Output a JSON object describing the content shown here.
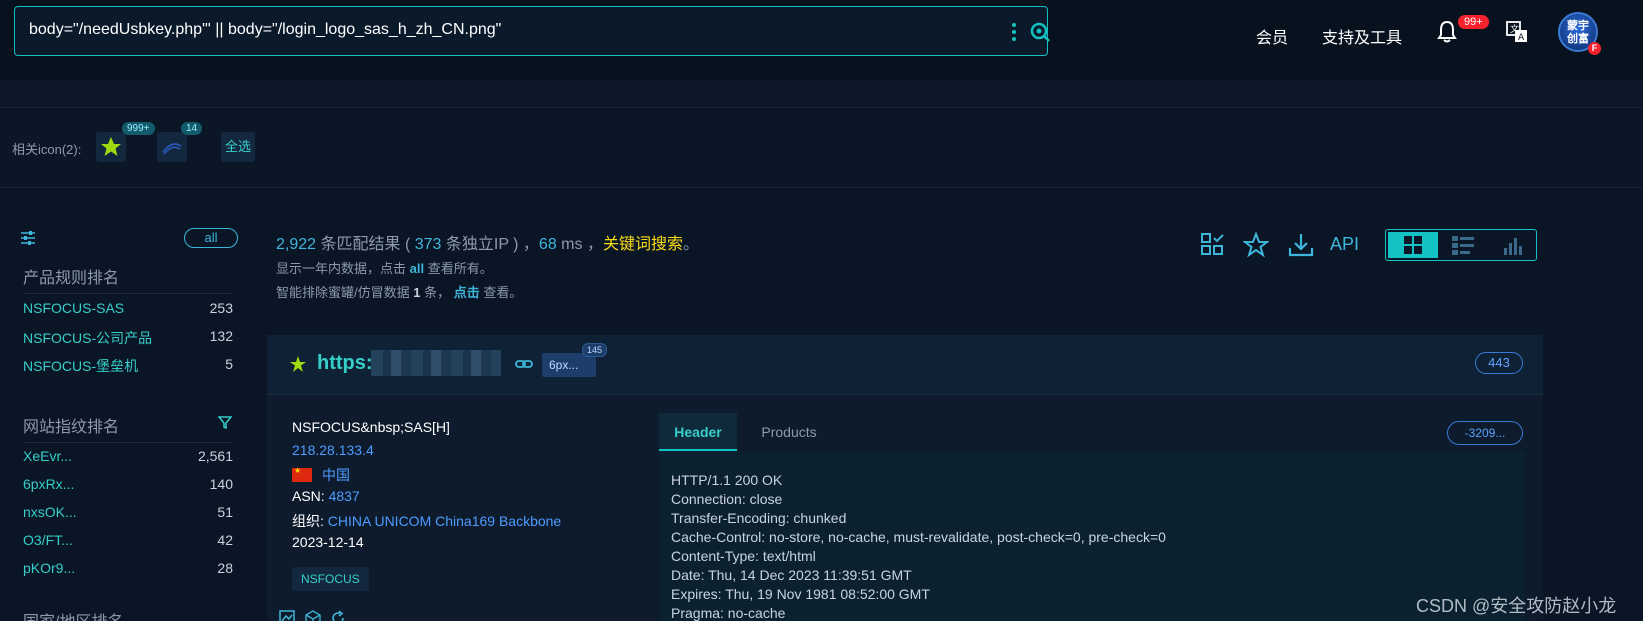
{
  "search": {
    "query": "body=\"/needUsbkey.php\"' || body=\"/login_logo_sas_h_zh_CN.png\""
  },
  "nav": {
    "member": "会员",
    "support": "支持及工具",
    "notify_badge": "99+",
    "avatar_line1": "蒙宇",
    "avatar_line2": "创富",
    "avatar_tag": "F"
  },
  "related_icons": {
    "label": "相关icon(2):",
    "icon1_count": "999+",
    "icon2_count": "14",
    "select_all": "全选"
  },
  "sidebar": {
    "all_label": "all",
    "product_title": "产品规则排名",
    "products": [
      {
        "name": "NSFOCUS-SAS",
        "count": "253"
      },
      {
        "name": "NSFOCUS-公司产品",
        "count": "132"
      },
      {
        "name": "NSFOCUS-堡垒机",
        "count": "5"
      }
    ],
    "fingerprint_title": "网站指纹排名",
    "fingerprints": [
      {
        "name": "XeEvr...",
        "count": "2,561"
      },
      {
        "name": "6pxRx...",
        "count": "140"
      },
      {
        "name": "nxsOK...",
        "count": "51"
      },
      {
        "name": "O3/FT...",
        "count": "42"
      },
      {
        "name": "pKOr9...",
        "count": "28"
      }
    ],
    "third_title": "国家/地区排名"
  },
  "results": {
    "count": "2,922",
    "count_suffix": " 条匹配结果 ( ",
    "ip_count": "373",
    "ip_suffix": " 条独立IP ) ，",
    "ms": "68",
    "ms_suffix": " ms ，",
    "keyword_search": "关键词搜索",
    "keyword_end": "。",
    "line2_prefix": "显示一年内数据，点击 ",
    "line2_all": "all",
    "line2_suffix": " 查看所有。",
    "line3_prefix": "智能排除蜜罐/仿冒数据 ",
    "line3_num": "1",
    "line3_mid": " 条， ",
    "line3_click": "点击",
    "line3_suffix": " 查看。",
    "api_label": "API"
  },
  "card": {
    "url": "https:",
    "chip_label": "6px...",
    "chip_count": "145",
    "port": "443",
    "title_line": "NSFOCUS&nbsp;SAS[H]",
    "ip": "218.28.133.4",
    "country": "中国",
    "asn_label": "ASN: ",
    "asn": "4837",
    "org_label": "组织: ",
    "org": "CHINA UNICOM China169 Backbone",
    "date": "2023-12-14",
    "tag": "NSFOCUS",
    "tab_header": "Header",
    "tab_products": "Products",
    "hash": "-3209...",
    "headers": [
      "HTTP/1.1 200 OK",
      "Connection: close",
      "Transfer-Encoding: chunked",
      "Cache-Control: no-store, no-cache, must-revalidate, post-check=0, pre-check=0",
      "Content-Type: text/html",
      "Date: Thu, 14 Dec 2023 11:39:51 GMT",
      "Expires: Thu, 19 Nov 1981 08:52:00 GMT",
      "Pragma: no-cache"
    ]
  },
  "watermark": "CSDN @安全攻防赵小龙",
  "colors": {
    "accent": "#13c2c2",
    "link": "#4d9cff",
    "keyword": "#fadb14",
    "badge": "#f5222d"
  }
}
